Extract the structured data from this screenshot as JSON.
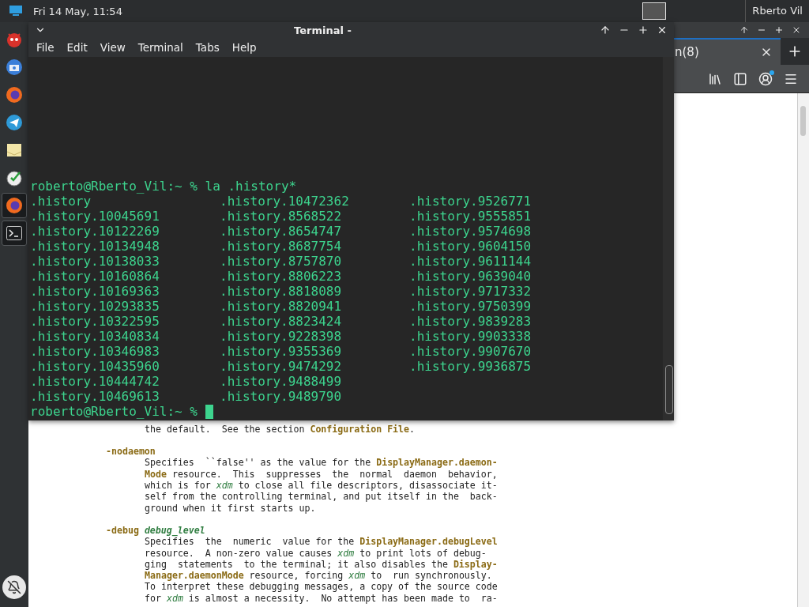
{
  "top_bar": {
    "clock": "Fri 14 May, 11:54",
    "user": "Rberto Vil"
  },
  "dock": {
    "items": [
      {
        "kind": "daemon",
        "selected": false
      },
      {
        "kind": "package",
        "selected": false
      },
      {
        "kind": "browser",
        "selected": false
      },
      {
        "kind": "plane",
        "selected": false
      },
      {
        "kind": "envelope",
        "selected": false
      },
      {
        "kind": "clock",
        "selected": false
      },
      {
        "kind": "browser",
        "selected": true
      },
      {
        "kind": "terminal",
        "selected": true
      }
    ]
  },
  "browser": {
    "tab": {
      "label": "n(8)"
    },
    "page_lines": [
      {
        "kind": "text",
        "text": "the default.  See the section **Configuration File**."
      },
      {
        "kind": "option",
        "flag": "-nodaemon",
        "body": "Specifies  ``false'' as the value for the **DisplayManager.daemon-**\n**Mode** resource.  This  suppresses  the  normal  daemon  behavior,\nwhich is for *xdm* to close all file descriptors, disassociate it-\nself from the controlling terminal, and put itself in the  back-\nground when it first starts up."
      },
      {
        "kind": "option",
        "flag": "-debug",
        "arg": "debug_level",
        "body": "Specifies  the  numeric  value for the **DisplayManager.debugLevel**\nresource.  A non-zero value causes *xdm* to print lots of debug-\nging  statements  to the terminal; it also disables the **Display-**\n**Manager.daemonMode** resource, forcing *xdm* to  run synchronously.\nTo interpret these debugging messages, a copy of the source code\nfor *xdm* is almost a necessity.  No attempt has been made to  ra-"
      }
    ]
  },
  "terminal": {
    "title": "Terminal -",
    "menu": [
      "File",
      "Edit",
      "View",
      "Terminal",
      "Tabs",
      "Help"
    ],
    "command_line": "roberto@Rberto_Vil:~ % la .history*",
    "listing": [
      [
        ".history",
        ".history.10045691",
        ".history.10122269",
        ".history.10134948",
        ".history.10138033",
        ".history.10160864",
        ".history.10169363",
        ".history.10293835",
        ".history.10322595",
        ".history.10340834",
        ".history.10346983",
        ".history.10435960",
        ".history.10444742",
        ".history.10469613"
      ],
      [
        ".history.10472362",
        ".history.8568522",
        ".history.8654747",
        ".history.8687754",
        ".history.8757870",
        ".history.8806223",
        ".history.8818089",
        ".history.8820941",
        ".history.8823424",
        ".history.9228398",
        ".history.9355369",
        ".history.9474292",
        ".history.9488499",
        ".history.9489790"
      ],
      [
        ".history.9526771",
        ".history.9555851",
        ".history.9574698",
        ".history.9604150",
        ".history.9611144",
        ".history.9639040",
        ".history.9717332",
        ".history.9750399",
        ".history.9839283",
        ".history.9903338",
        ".history.9907670",
        ".history.9936875"
      ]
    ],
    "prompt": "roberto@Rberto_Vil:~ %"
  }
}
